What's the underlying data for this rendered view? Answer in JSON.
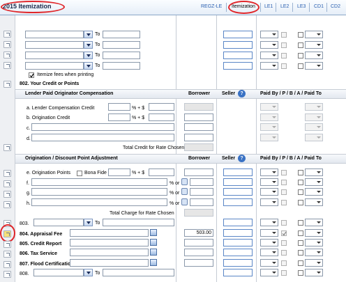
{
  "header": {
    "title": "2015 Itemization",
    "tabs": [
      "REGZ-LE",
      "Itemization",
      "LE1",
      "LE2",
      "LE3",
      "CD1",
      "CD2"
    ]
  },
  "to": "To",
  "itemize_label": "Itemize fees when printing",
  "sec802": "802.  Your Credit or Points",
  "lender": {
    "title": "Lender Paid Originator Compensation",
    "borrower": "Borrower",
    "seller": "Seller",
    "paid_by": "Paid By  / P / B / A / Paid To",
    "a": "a.  Lender Compensation Credit",
    "b": "b.  Origination Credit",
    "c": "c.",
    "d": "d.",
    "pct": "% + $",
    "total": "Total Credit for Rate Chosen"
  },
  "orig": {
    "title": "Origination / Discount Point Adjustment",
    "borrower": "Borrower",
    "seller": "Seller",
    "paid_by": "Paid By  / P / B / A / Paid To",
    "e": "e.  Origination Points",
    "bona": "Bona Fide",
    "pct": "% + $",
    "f": "f.",
    "g": "g.",
    "h": "h.",
    "pct_or": "% or",
    "total": "Total Charge for Rate Chosen"
  },
  "lines": {
    "l803": "803.",
    "l804": "804.  Appraisal Fee",
    "l805": "805.  Credit Report",
    "l806": "806.  Tax Service",
    "l807": "807.  Flood Certification",
    "l808": "808.",
    "appraisal_value": "503.00"
  },
  "help_glyph": "?"
}
